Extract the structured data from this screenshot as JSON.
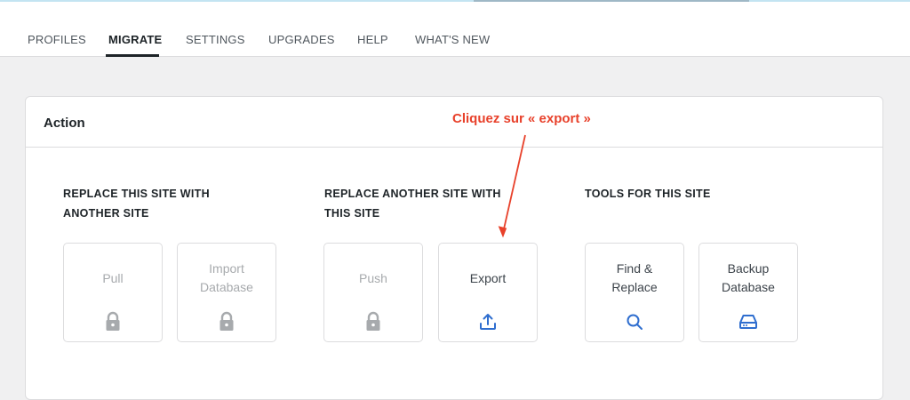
{
  "nav": {
    "tabs": [
      {
        "label": "PROFILES"
      },
      {
        "label": "MIGRATE"
      },
      {
        "label": "SETTINGS"
      },
      {
        "label": "UPGRADES"
      },
      {
        "label": "HELP"
      },
      {
        "label": "WHAT'S NEW"
      }
    ],
    "active_tab": "MIGRATE"
  },
  "panel": {
    "title": "Action",
    "groups": [
      {
        "title_line1": "REPLACE THIS SITE WITH",
        "title_line2": "ANOTHER SITE",
        "cards": [
          {
            "label_line1": "Pull",
            "label_line2": "",
            "icon": "lock-icon",
            "state": "disabled"
          },
          {
            "label_line1": "Import",
            "label_line2": "Database",
            "icon": "lock-icon",
            "state": "disabled"
          }
        ]
      },
      {
        "title_line1": "REPLACE ANOTHER SITE WITH",
        "title_line2": "THIS SITE",
        "cards": [
          {
            "label_line1": "Push",
            "label_line2": "",
            "icon": "lock-icon",
            "state": "disabled"
          },
          {
            "label_line1": "Export",
            "label_line2": "",
            "icon": "upload-icon",
            "state": "enabled"
          }
        ]
      },
      {
        "title_line1": "TOOLS FOR THIS SITE",
        "title_line2": "",
        "cards": [
          {
            "label_line1": "Find &",
            "label_line2": "Replace",
            "icon": "search-icon",
            "state": "enabled"
          },
          {
            "label_line1": "Backup",
            "label_line2": "Database",
            "icon": "drive-icon",
            "state": "enabled"
          }
        ]
      }
    ]
  },
  "annotation": {
    "text": "Cliquez sur « export »",
    "color": "#e8412b"
  },
  "colors": {
    "accent_blue": "#2f6ecf",
    "disabled_icon": "#a7aaad"
  }
}
